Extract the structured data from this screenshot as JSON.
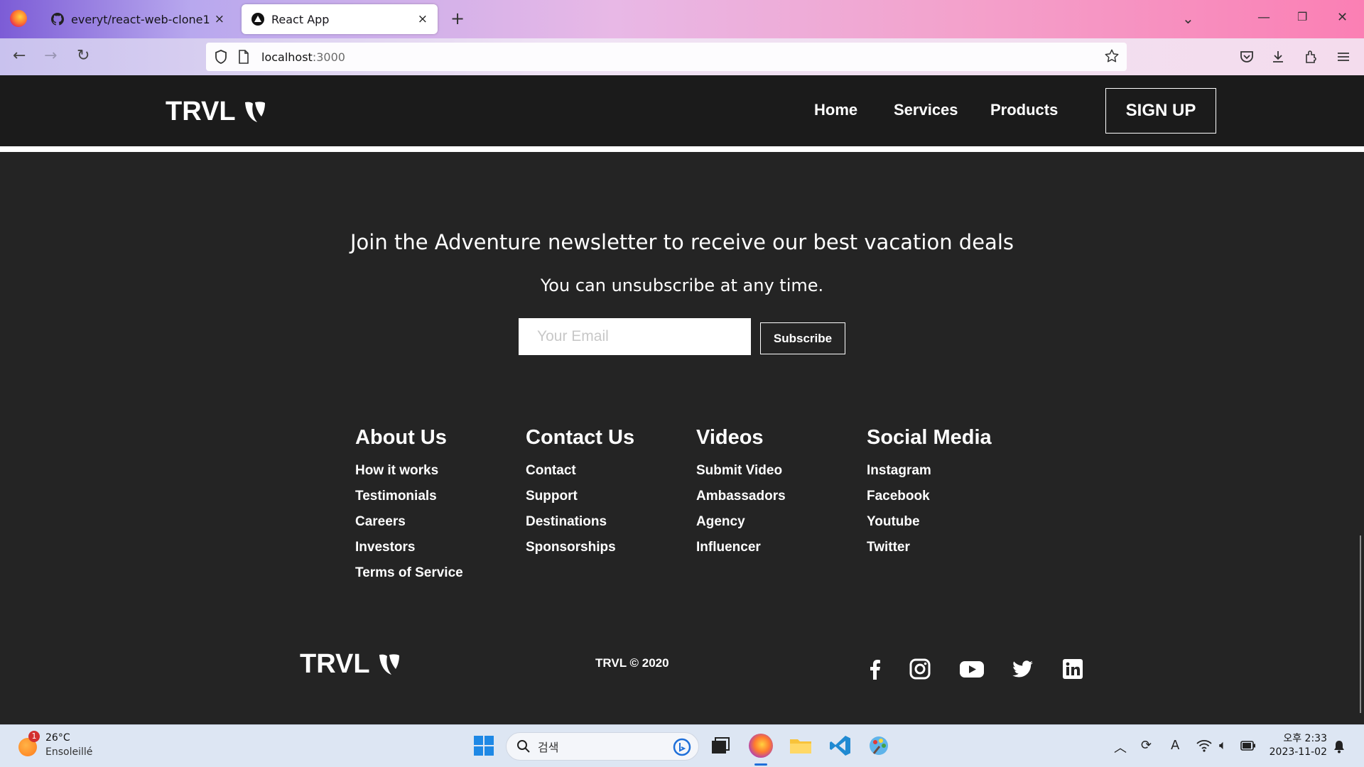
{
  "browser": {
    "tabs": [
      {
        "title": "everyt/react-web-clone1",
        "close": "×"
      },
      {
        "title": "React App",
        "close": "×"
      }
    ],
    "new_tab": "+",
    "tab_list": "⌄",
    "url_host": "localhost",
    "url_port": ":3000"
  },
  "site": {
    "brand": "TRVL",
    "nav": {
      "home": "Home",
      "services": "Services",
      "products": "Products",
      "signup": "SIGN UP"
    }
  },
  "newsletter": {
    "title": "Join the Adventure newsletter to receive our best vacation deals",
    "subtitle": "You can unsubscribe at any time.",
    "email_placeholder": "Your Email",
    "subscribe": "Subscribe"
  },
  "footer": {
    "columns": [
      {
        "heading": "About Us",
        "links": [
          "How it works",
          "Testimonials",
          "Careers",
          "Investors",
          "Terms of Service"
        ]
      },
      {
        "heading": "Contact Us",
        "links": [
          "Contact",
          "Support",
          "Destinations",
          "Sponsorships"
        ]
      },
      {
        "heading": "Videos",
        "links": [
          "Submit Video",
          "Ambassadors",
          "Agency",
          "Influencer"
        ]
      },
      {
        "heading": "Social Media",
        "links": [
          "Instagram",
          "Facebook",
          "Youtube",
          "Twitter"
        ]
      }
    ],
    "brand": "TRVL",
    "copyright": "TRVL © 2020",
    "social_icons": [
      "facebook-icon",
      "instagram-icon",
      "youtube-icon",
      "twitter-icon",
      "linkedin-icon"
    ]
  },
  "taskbar": {
    "weather_temp": "26°C",
    "weather_desc": "Ensoleillé",
    "weather_badge": "1",
    "search_placeholder": "검색",
    "time": "오후 2:33",
    "date": "2023-11-02"
  },
  "colors": {
    "page_bg": "#242424",
    "nav_bg": "#1b1b1b",
    "text": "#ffffff"
  }
}
